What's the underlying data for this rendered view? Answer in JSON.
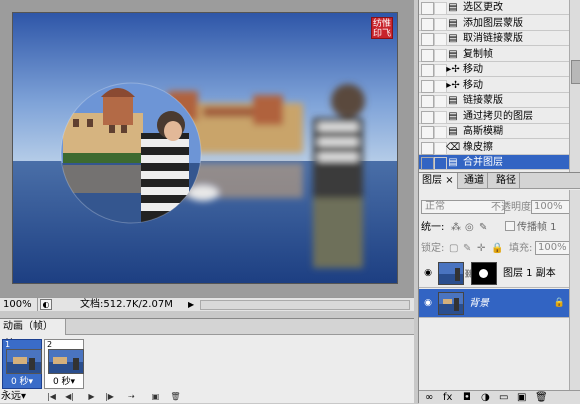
{
  "canvas": {
    "seal_text": "纺惟\n印飞",
    "zoom": "100%",
    "doc_info": "文档:512.7K/2.07M",
    "status_arrow": "▶"
  },
  "animation": {
    "tab_label": "动画（帧）",
    "frames": [
      {
        "number": "1",
        "delay": "0 秒▾",
        "selected": true
      },
      {
        "number": "2",
        "delay": "0 秒▾",
        "selected": false
      }
    ],
    "loop": "永远",
    "loop_arrow": "▾",
    "toolbar_icons": [
      "|◀",
      "◀|",
      "▶",
      "|▶",
      "⇢",
      "▣",
      "🗑"
    ]
  },
  "actions": {
    "items": [
      {
        "label": "选区更改",
        "icon": "document-icon",
        "glyph": "▤",
        "selected": false
      },
      {
        "label": "添加图层蒙版",
        "icon": "document-icon",
        "glyph": "▤",
        "selected": false
      },
      {
        "label": "取消链接蒙版",
        "icon": "document-icon",
        "glyph": "▤",
        "selected": false
      },
      {
        "label": "复制帧",
        "icon": "document-icon",
        "glyph": "▤",
        "selected": false
      },
      {
        "label": "移动",
        "icon": "move-icon",
        "glyph": "▸✢",
        "selected": false
      },
      {
        "label": "移动",
        "icon": "move-icon",
        "glyph": "▸✢",
        "selected": false
      },
      {
        "label": "链接蒙版",
        "icon": "document-icon",
        "glyph": "▤",
        "selected": false
      },
      {
        "label": "通过拷贝的图层",
        "icon": "document-icon",
        "glyph": "▤",
        "selected": false
      },
      {
        "label": "高斯模糊",
        "icon": "document-icon",
        "glyph": "▤",
        "selected": false
      },
      {
        "label": "橡皮擦",
        "icon": "eraser-icon",
        "glyph": "⌫",
        "selected": false
      },
      {
        "label": "合并图层",
        "icon": "document-icon",
        "glyph": "▤",
        "selected": true
      }
    ]
  },
  "layers": {
    "tabs": [
      {
        "label": "图层",
        "close": "×",
        "active": true
      },
      {
        "label": "通道",
        "active": false
      },
      {
        "label": "路径",
        "active": false
      }
    ],
    "blend_mode": "正常",
    "opacity_label": "不透明度:",
    "opacity_value": "100%",
    "unify_label": "统一:",
    "propagate_label": "传播帧 1",
    "lock_label": "锁定:",
    "fill_label": "填充:",
    "fill_value": "100%",
    "items": [
      {
        "name": "图层 1 副本",
        "has_mask": true,
        "selected": false,
        "locked": false
      },
      {
        "name": "背景",
        "has_mask": false,
        "selected": true,
        "locked": true
      }
    ]
  },
  "colors": {
    "selection": "#3264c3",
    "panel_bg": "#ececec",
    "seal_red": "#c8242c"
  }
}
